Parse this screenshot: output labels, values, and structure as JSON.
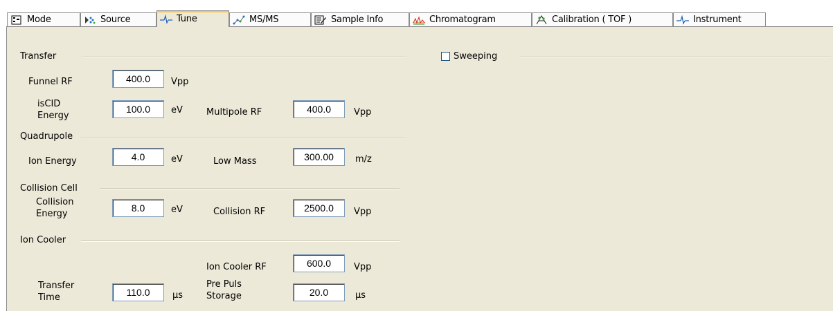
{
  "tabs": [
    {
      "label": "Mode",
      "icon": "mode-icon"
    },
    {
      "label": "Source",
      "icon": "source-icon"
    },
    {
      "label": "Tune",
      "icon": "tune-icon",
      "active": true
    },
    {
      "label": "MS/MS",
      "icon": "msms-icon"
    },
    {
      "label": "Sample Info",
      "icon": "sample-info-icon"
    },
    {
      "label": "Chromatogram",
      "icon": "chromatogram-icon"
    },
    {
      "label": "Calibration ( TOF )",
      "icon": "calibration-icon"
    },
    {
      "label": "Instrument",
      "icon": "instrument-icon"
    }
  ],
  "transfer": {
    "title": "Transfer",
    "funnel_rf": {
      "label": "Funnel RF",
      "value": "400.0",
      "unit": "Vpp"
    },
    "iscid_energy": {
      "label_line1": "isCID",
      "label_line2": "Energy",
      "value": "100.0",
      "unit": "eV"
    },
    "multipole_rf": {
      "label": "Multipole RF",
      "value": "400.0",
      "unit": "Vpp"
    }
  },
  "quadrupole": {
    "title": "Quadrupole",
    "ion_energy": {
      "label": "Ion Energy",
      "value": "4.0",
      "unit": "eV"
    },
    "low_mass": {
      "label": "Low Mass",
      "value": "300.00",
      "unit": "m/z"
    }
  },
  "collision_cell": {
    "title": "Collision Cell",
    "collision_energy": {
      "label_line1": "Collision",
      "label_line2": "Energy",
      "value": "8.0",
      "unit": "eV"
    },
    "collision_rf": {
      "label": "Collision RF",
      "value": "2500.0",
      "unit": "Vpp"
    }
  },
  "ion_cooler": {
    "title": "Ion Cooler",
    "ion_cooler_rf": {
      "label": "Ion Cooler RF",
      "value": "600.0",
      "unit": "Vpp"
    },
    "transfer_time": {
      "label_line1": "Transfer",
      "label_line2": "Time",
      "value": "110.0",
      "unit": "µs"
    },
    "pre_puls_storage": {
      "label_line1": "Pre Puls",
      "label_line2": "Storage",
      "value": "20.0",
      "unit": "µs"
    }
  },
  "sweeping": {
    "label": "Sweeping",
    "checked": false
  },
  "colors": {
    "panel_bg": "#ece9d8",
    "active_tab_accent": "#ffc83c",
    "field_border": "#7f9db9"
  }
}
